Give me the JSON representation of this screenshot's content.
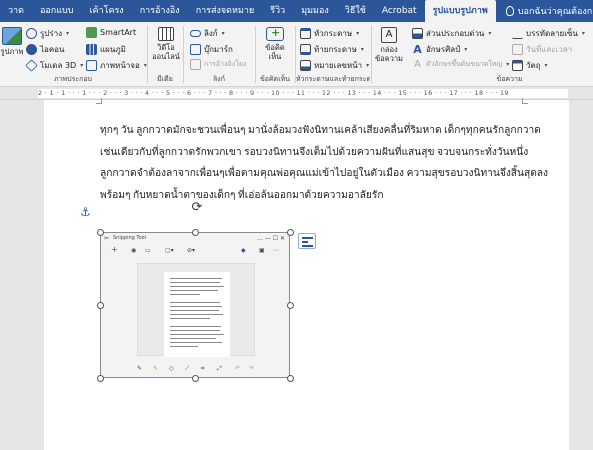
{
  "tabs": [
    {
      "label": "วาด",
      "active": false
    },
    {
      "label": "ออกแบบ",
      "active": false
    },
    {
      "label": "เค้าโครง",
      "active": false
    },
    {
      "label": "การอ้างอิง",
      "active": false
    },
    {
      "label": "การส่งจดหมาย",
      "active": false
    },
    {
      "label": "รีวิว",
      "active": false
    },
    {
      "label": "มุมมอง",
      "active": false
    },
    {
      "label": "วิธีใช้",
      "active": false
    },
    {
      "label": "Acrobat",
      "active": false
    },
    {
      "label": "รูปแบบรูปภาพ",
      "active": true
    }
  ],
  "tell_me": "บอกฉันว่าคุณต้องการทำอะไร",
  "ribbon": {
    "illustrations": {
      "label": "ภาพประกอบ",
      "pictures": "รูปภาพ",
      "shapes": "รูปร่าง",
      "icons": "ไอคอน",
      "models3d": "โมเดล 3D",
      "smartart": "SmartArt",
      "chart": "แผนภูมิ",
      "screenshot": "ภาพหน้าจอ"
    },
    "media": {
      "label": "มีเดีย",
      "online_video": "วิดีโอออนไลน์"
    },
    "links": {
      "label": "ลิงก์",
      "link": "ลิงก์",
      "bookmark": "บุ๊กมาร์ก",
      "cross_ref": "การอ้างอิงโยง"
    },
    "comments": {
      "label": "ข้อคิดเห็น",
      "comment": "ข้อคิดเห็น"
    },
    "header_footer": {
      "label": "หัวกระดาษและท้ายกระดาษ",
      "header": "หัวกระดาษ",
      "footer": "ท้ายกระดาษ",
      "page_number": "หมายเลขหน้า"
    },
    "text": {
      "label": "ข้อความ",
      "text_box": "กล่องข้อความ",
      "quick_parts": "ส่วนประกอบด่วน",
      "wordart": "อักษรศิลป์",
      "drop_cap": "ตัวอักษรขึ้นต้นขนาดใหญ่"
    },
    "symbols": {
      "signature_line": "บรรทัดลายเซ็น",
      "date_time": "วันที่และเวลา",
      "object": "วัตถุ"
    }
  },
  "ruler_text": "2 · 1 · 1 · · · 1 · · · 2 · · · 3 · · · 4 · · · 5 · · · 6 · · · 7 · · · 8 · · · 9 · · · 10 · · · 11 · · · 12 · · · 13 · · · 14 · · · 15 · · · 16 · · · 17 · · · 18 · · · 19",
  "document": {
    "lines": [
      "ทุกๆ วัน ลูกกวาดมักจะชวนเพื่อนๆ มานั่งล้อมวงฟังนิทานเคล้าเสียงคลื่นที่ริมหาด เด็กๆทุกคนรักลูกกวาด",
      "เช่นเดียวกับที่ลูกกวาดรักพวกเขา รอบวงนิทานจึงเต็มไปด้วยความฝันที่แสนสุข จวบจนกระทั่งวันหนึ่ง",
      "ลูกกวาดจำต้องลาจากเพื่อนๆเพื่อตามคุณพ่อคุณแม่เข้าไปอยู่ในตัวเมือง ความสุขรอบวงนิทานจึงสิ้นสุดลง",
      "พร้อมๆ กับหยาดน้ำตาของเด็กๆ ที่เอ่อล้นออกมาด้วยความอาลัยรัก"
    ]
  },
  "snipping_tool": {
    "title": "Snipping Tool",
    "new_button": "+",
    "window_controls": "…   —   ☐   ✕"
  }
}
